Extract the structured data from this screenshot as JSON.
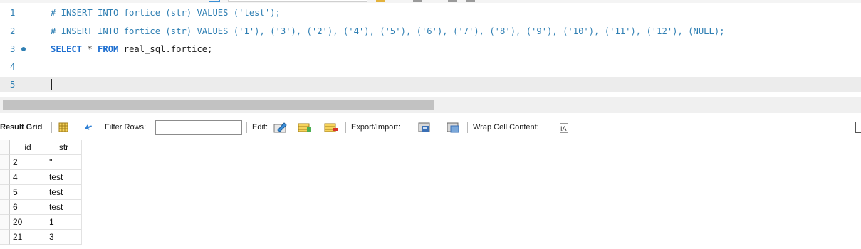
{
  "editor": {
    "lines": [
      {
        "num": "1",
        "parts": [
          {
            "cls": "comment",
            "text": "# INSERT INTO fortice (str) VALUES ('test');"
          }
        ]
      },
      {
        "num": "2",
        "parts": [
          {
            "cls": "comment",
            "text": "# INSERT INTO fortice (str) VALUES ('1'), ('3'), ('2'), ('4'), ('5'), ('6'), ('7'), ('8'), ('9'), ('10'), ('11'), ('12'), (NULL);"
          }
        ]
      },
      {
        "num": "3",
        "marker": true,
        "parts": [
          {
            "cls": "kw",
            "text": "SELECT"
          },
          {
            "cls": "plain",
            "text": " * "
          },
          {
            "cls": "kw",
            "text": "FROM"
          },
          {
            "cls": "plain",
            "text": " real_sql.fortice;"
          }
        ]
      },
      {
        "num": "4",
        "parts": []
      },
      {
        "num": "5",
        "current": true,
        "caret": true,
        "parts": []
      }
    ]
  },
  "result_toolbar": {
    "result_grid_label": "Result Grid",
    "grid_icon": "grid-icon",
    "refresh_icon": "refresh-icon",
    "filter_rows_label": "Filter Rows:",
    "filter_rows_value": "",
    "edit_label": "Edit:",
    "edit_icons": [
      "edit-row-icon",
      "insert-row-icon",
      "delete-row-icon"
    ],
    "export_import_label": "Export/Import:",
    "export_icons": [
      "export-icon",
      "import-icon"
    ],
    "wrap_label": "Wrap Cell Content:",
    "wrap_icon": "wrap-cell-icon"
  },
  "grid": {
    "columns": [
      "id",
      "str"
    ],
    "rows": [
      [
        "2",
        "''"
      ],
      [
        "4",
        "test"
      ],
      [
        "5",
        "test"
      ],
      [
        "6",
        "test"
      ],
      [
        "20",
        "1"
      ],
      [
        "21",
        "3"
      ]
    ]
  },
  "colors": {
    "comment": "#2f7fb3",
    "keyword": "#1e6fd0",
    "current_line": "#ececec",
    "scroll_thumb": "#c2c2c2"
  }
}
